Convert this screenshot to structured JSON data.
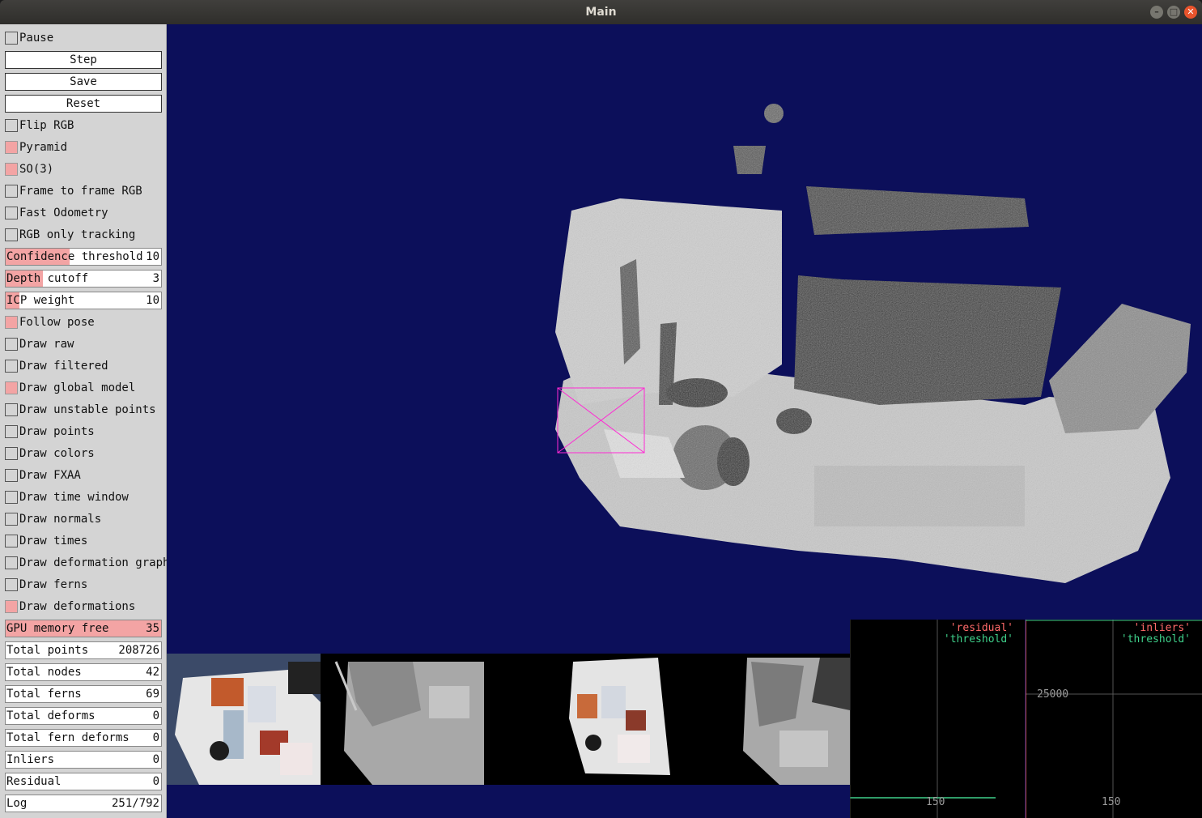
{
  "window": {
    "title": "Main"
  },
  "panel": {
    "pause": {
      "label": "Pause",
      "checked": false
    },
    "step": "Step",
    "save": "Save",
    "reset": "Reset",
    "options": [
      {
        "label": "Flip RGB",
        "checked": false
      },
      {
        "label": "Pyramid",
        "checked": true
      },
      {
        "label": "SO(3)",
        "checked": true
      },
      {
        "label": "Frame to frame RGB",
        "checked": false
      },
      {
        "label": "Fast Odometry",
        "checked": false
      },
      {
        "label": "RGB only tracking",
        "checked": false
      }
    ],
    "sliders": [
      {
        "label": "Confidence threshold",
        "value": "10",
        "fill": 0.41
      },
      {
        "label": "Depth cutoff",
        "value": "3",
        "fill": 0.24
      },
      {
        "label": "ICP weight",
        "value": "10",
        "fill": 0.09
      }
    ],
    "draw_options": [
      {
        "label": "Follow pose",
        "checked": true
      },
      {
        "label": "Draw raw",
        "checked": false
      },
      {
        "label": "Draw filtered",
        "checked": false
      },
      {
        "label": "Draw global model",
        "checked": true
      },
      {
        "label": "Draw unstable points",
        "checked": false
      },
      {
        "label": "Draw points",
        "checked": false
      },
      {
        "label": "Draw colors",
        "checked": false
      },
      {
        "label": "Draw FXAA",
        "checked": false
      },
      {
        "label": "Draw time window",
        "checked": false
      },
      {
        "label": "Draw normals",
        "checked": false
      },
      {
        "label": "Draw times",
        "checked": false
      },
      {
        "label": "Draw deformation graph",
        "checked": false
      },
      {
        "label": "Draw ferns",
        "checked": false
      },
      {
        "label": "Draw deformations",
        "checked": true
      }
    ],
    "stats": [
      {
        "label": "GPU memory free",
        "value": "35",
        "highlight": true
      },
      {
        "label": "Total points",
        "value": "208726"
      },
      {
        "label": "Total nodes",
        "value": "42"
      },
      {
        "label": "Total ferns",
        "value": "69"
      },
      {
        "label": "Total deforms",
        "value": "0"
      },
      {
        "label": "Total fern deforms",
        "value": "0"
      },
      {
        "label": "Inliers",
        "value": "0"
      },
      {
        "label": "Residual",
        "value": "0"
      },
      {
        "label": "Log",
        "value": "251/792"
      }
    ]
  },
  "plots": [
    {
      "legend": [
        "'residual'",
        "'threshold'"
      ],
      "colors": [
        "#ff6a6a",
        "#3fd08a"
      ],
      "ticks": [
        "150"
      ]
    },
    {
      "legend": [
        "'inliers'",
        "'threshold'"
      ],
      "colors": [
        "#ff6a6a",
        "#3fd08a"
      ],
      "ticks": [
        "25000",
        "150"
      ]
    }
  ],
  "colors": {
    "accent": "#f3a4a4",
    "background": "#0c0f5a"
  }
}
